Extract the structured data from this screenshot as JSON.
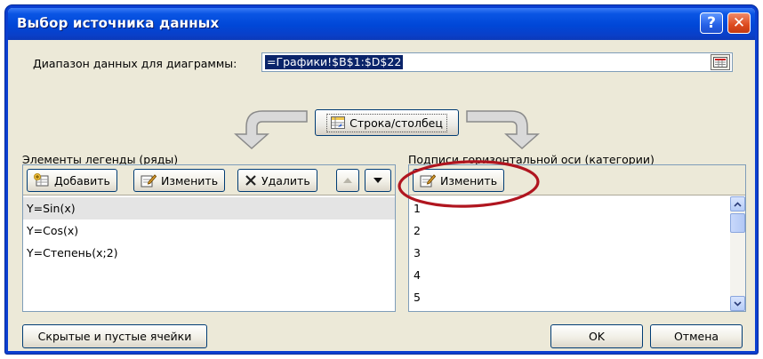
{
  "window": {
    "title": "Выбор источника данных",
    "help_symbol": "?",
    "close_symbol": "✕"
  },
  "range": {
    "label": "Диапазон данных для диаграммы:",
    "value": "=Графики!$B$1:$D$22"
  },
  "switch_button": {
    "label": "Строка/столбец"
  },
  "legend_section": {
    "label": "Элементы легенды (ряды)",
    "buttons": {
      "add": "Добавить",
      "edit": "Изменить",
      "delete": "Удалить"
    },
    "items": [
      {
        "label": "Y=Sin(x)",
        "selected": true
      },
      {
        "label": "Y=Cos(x)",
        "selected": false
      },
      {
        "label": "Y=Степень(x;2)",
        "selected": false
      }
    ]
  },
  "category_section": {
    "label": "Подписи горизонтальной оси (категории)",
    "buttons": {
      "edit": "Изменить"
    },
    "items": [
      "1",
      "2",
      "3",
      "4",
      "5"
    ]
  },
  "footer": {
    "hidden_cells": "Скрытые и пустые ячейки",
    "ok": "OK",
    "cancel": "Отмена"
  },
  "icons": {
    "add": "add-series-icon",
    "edit": "edit-pencil-icon",
    "delete": "delete-x-icon",
    "move_up": "arrow-up-icon",
    "move_down": "arrow-down-icon",
    "switch": "switch-row-column-icon",
    "collapse": "range-collapse-icon",
    "curved_arrows": "curved-arrow-icon"
  },
  "colors": {
    "titlebar": "#0047d7",
    "close_button": "#dd4b1f",
    "selection": "#0a246a",
    "highlight_ellipse": "#b0151f"
  }
}
